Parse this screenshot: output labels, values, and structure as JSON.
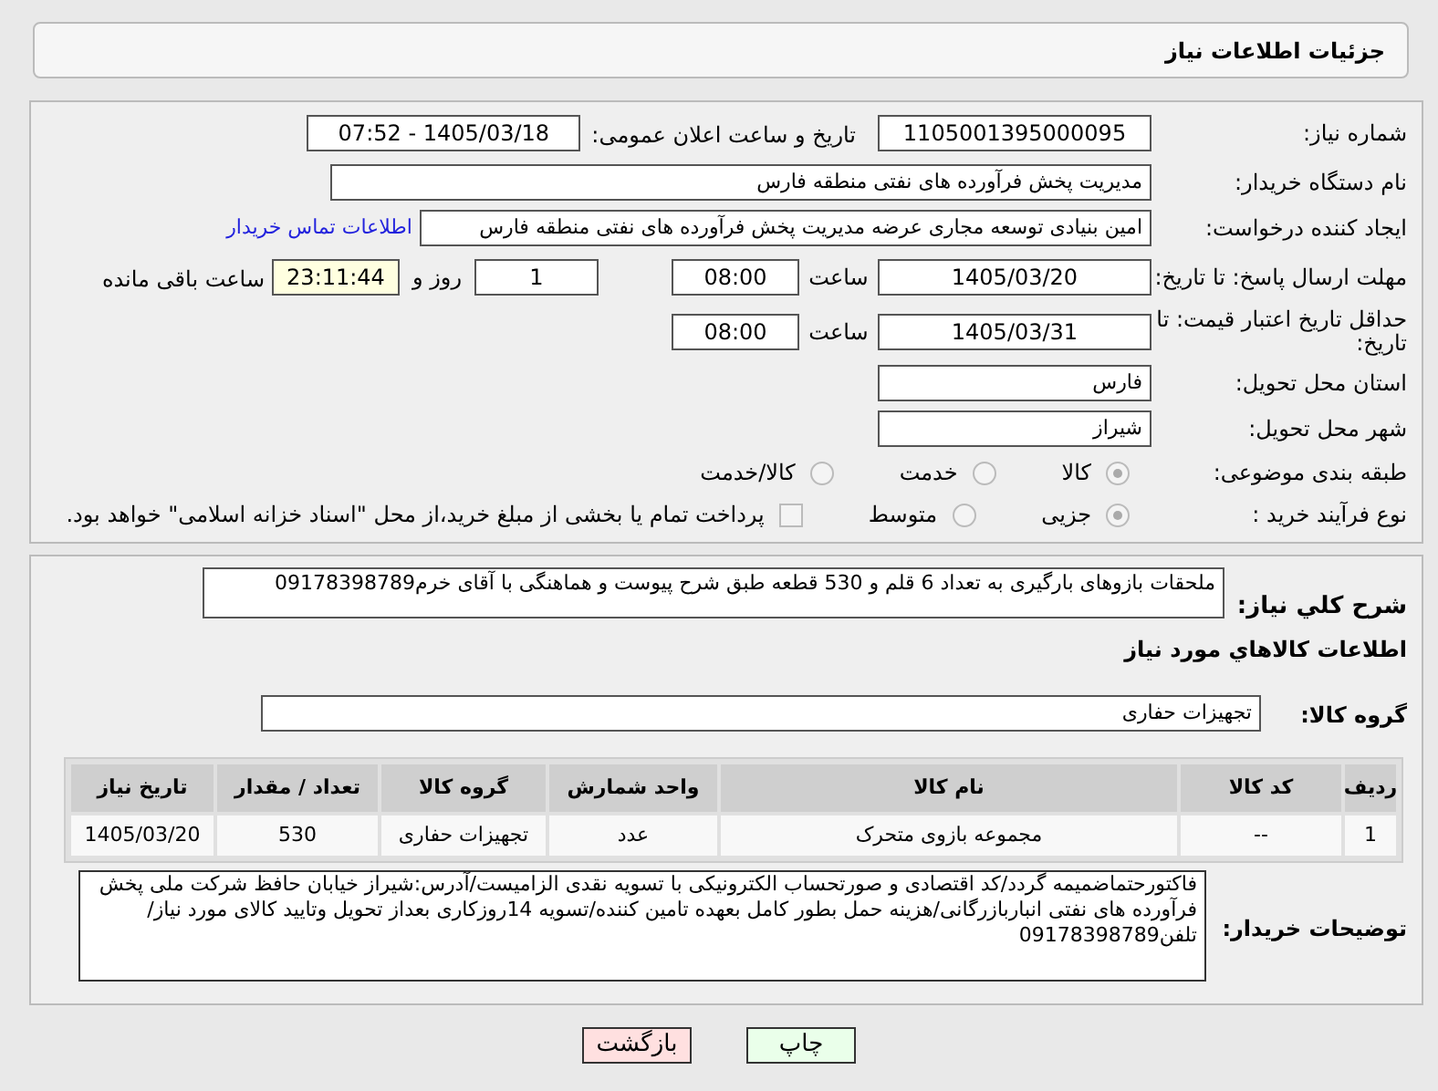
{
  "header": {
    "title": "جزئیات اطلاعات نیاز"
  },
  "need_number": {
    "label": "شماره نیاز:",
    "value": "1105001395000095"
  },
  "announce": {
    "label": "تاریخ و ساعت اعلان عمومی:",
    "value": "1405/03/18 - 07:52"
  },
  "buyer": {
    "label": "نام دستگاه خریدار:",
    "value": "مدیریت پخش فرآورده های نفتی منطقه فارس"
  },
  "requester": {
    "label": "ایجاد کننده درخواست:",
    "value": "امین بنیادی توسعه مجاری عرضه مدیریت پخش فرآورده های نفتی منطقه فارس",
    "link": "اطلاعات تماس خریدار"
  },
  "reply_deadline": {
    "label": "مهلت ارسال پاسخ: تا تاریخ:",
    "date": "1405/03/20",
    "time_label": "ساعت",
    "time": "08:00",
    "days": "1",
    "days_label": "روز و",
    "remaining": "23:11:44",
    "remaining_label": "ساعت باقی مانده"
  },
  "price_validity": {
    "label": "حداقل تاریخ اعتبار قیمت: تا تاریخ:",
    "date": "1405/03/31",
    "time_label": "ساعت",
    "time": "08:00"
  },
  "province": {
    "label": "استان محل تحویل:",
    "value": "فارس"
  },
  "city": {
    "label": "شهر محل تحویل:",
    "value": "شیراز"
  },
  "category": {
    "label": "طبقه بندی موضوعی:",
    "options": [
      {
        "label": "کالا",
        "selected": true
      },
      {
        "label": "خدمت",
        "selected": false
      },
      {
        "label": "کالا/خدمت",
        "selected": false
      }
    ]
  },
  "process": {
    "label": "نوع فرآیند خرید :",
    "options": [
      {
        "label": "جزیی",
        "selected": true
      },
      {
        "label": "متوسط",
        "selected": false
      }
    ],
    "payment": {
      "label": "پرداخت تمام یا بخشی از مبلغ خرید،از محل \"اسناد خزانه اسلامی\" خواهد بود.",
      "checked": false
    }
  },
  "description": {
    "label": "شرح کلي نياز:",
    "value": "ملحقات بازوهای بارگیری به تعداد 6 قلم و 530 قطعه طبق شرح پیوست و هماهنگی با آقای خرم09178398789"
  },
  "goods_title": "اطلاعات کالاهاي مورد نياز",
  "goods_group": {
    "label": "گروه کالا:",
    "value": "تجهیزات حفاری"
  },
  "table": {
    "columns": [
      "ردیف",
      "کد کالا",
      "نام کالا",
      "واحد شمارش",
      "گروه کالا",
      "تعداد / مقدار",
      "تاریخ نیاز"
    ],
    "rows": [
      [
        "1",
        "--",
        "مجموعه بازوی متحرک",
        "عدد",
        "تجهیزات حفاری",
        "530",
        "1405/03/20"
      ]
    ]
  },
  "buyer_notes": {
    "label": "توضیحات خریدار:",
    "value": "فاکتورحتماضمیمه گردد/کد اقتصادی و صورتحساب الکترونیکی با تسویه نقدی الزامیست/آدرس:شیراز خیابان حافظ شرکت ملی پخش فرآورده های نفتی انباربازرگانی/هزینه حمل بطور کامل بعهده تامین کننده/تسویه 14روزکاری بعداز تحویل وتایید کالای مورد نیاز/تلفن09178398789"
  },
  "buttons": [
    {
      "label": "چاپ",
      "kind": "print"
    },
    {
      "label": "بازگشت",
      "kind": "back"
    }
  ]
}
